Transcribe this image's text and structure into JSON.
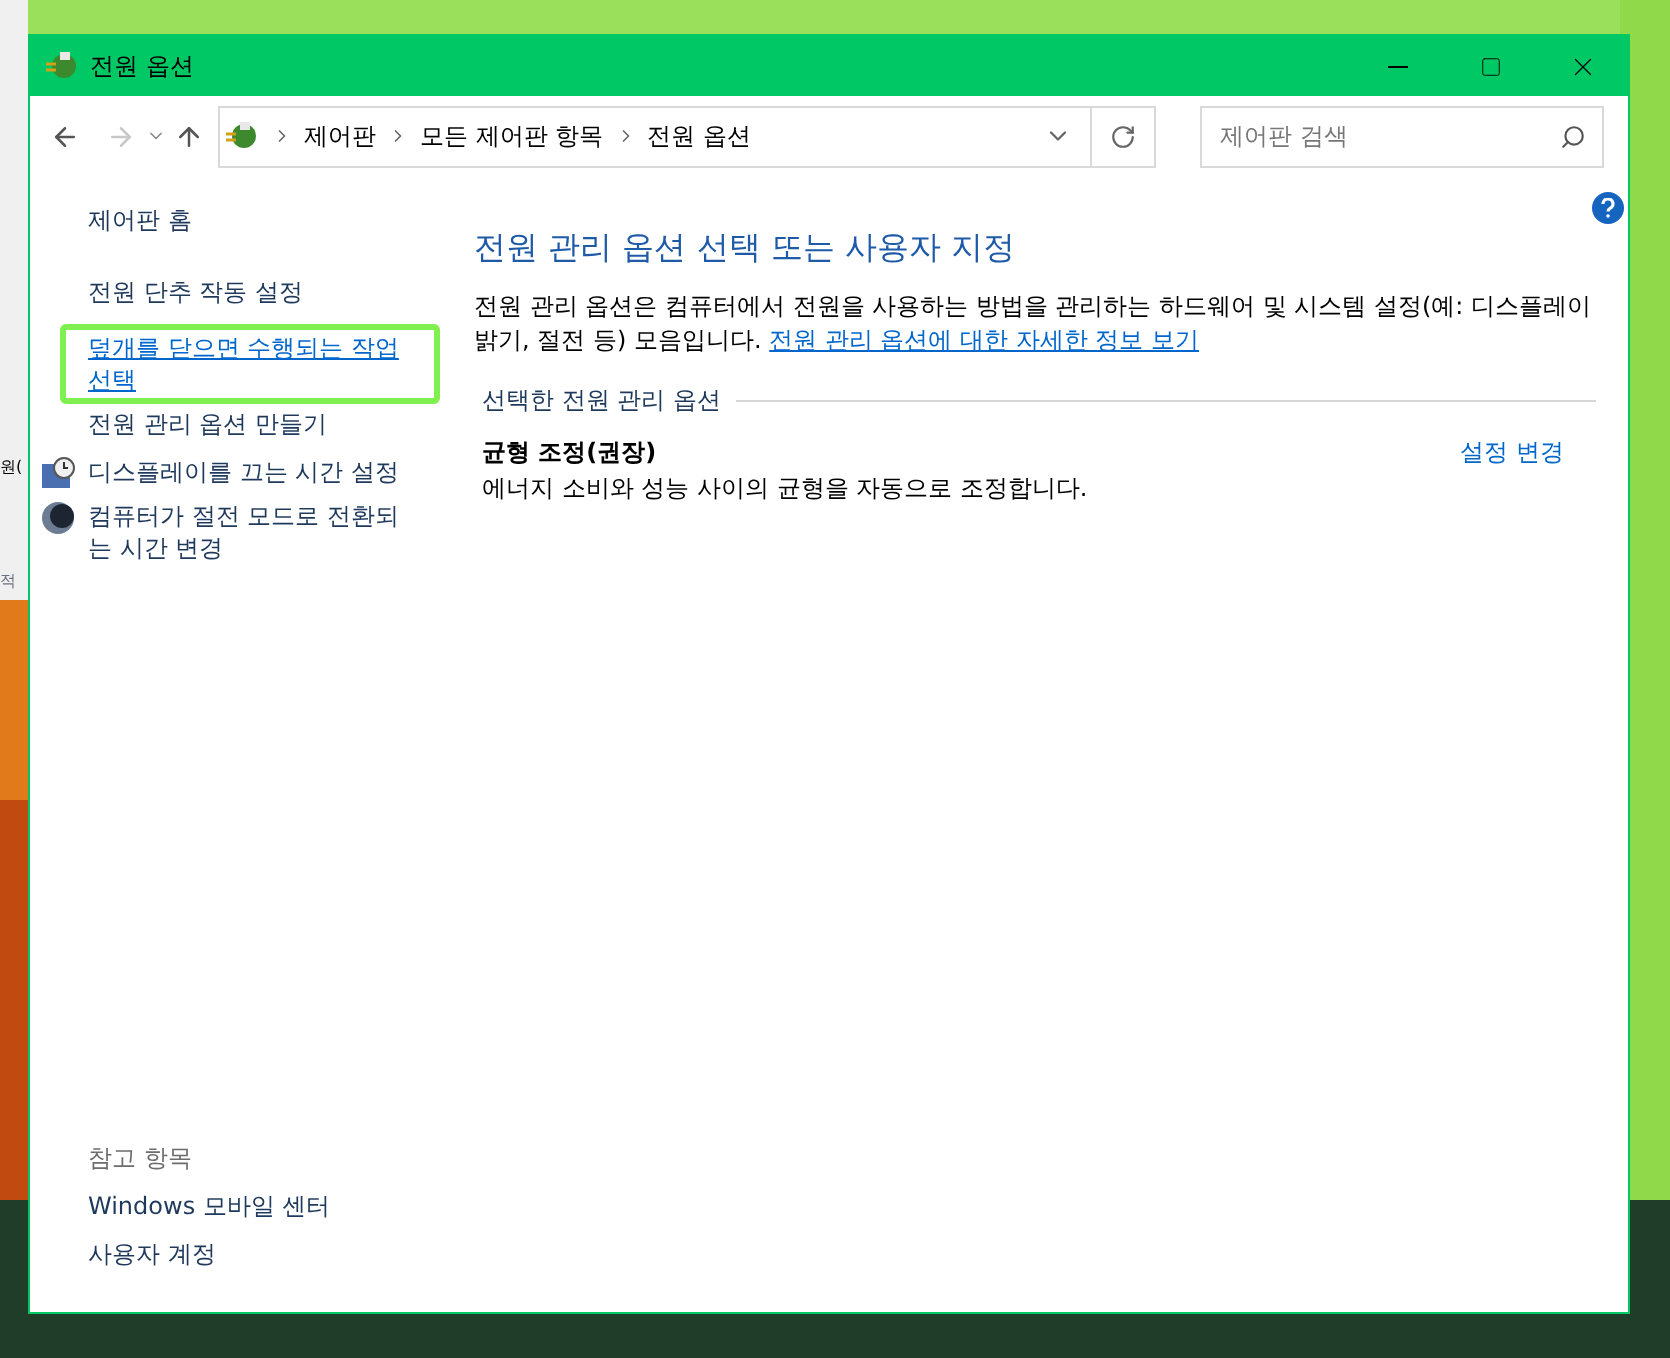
{
  "background_window": {
    "texts": [
      "원(",
      "적"
    ]
  },
  "window": {
    "title": "전원 옵션"
  },
  "nav": {
    "breadcrumb": [
      "제어판",
      "모든 제어판 항목",
      "전원 옵션"
    ],
    "search": {
      "placeholder": "제어판 검색"
    }
  },
  "sidebar": {
    "items": [
      {
        "label": "제어판 홈",
        "kind": "plain"
      },
      {
        "label": "전원 단추 작동 설정",
        "kind": "link"
      },
      {
        "label": "덮개를 닫으면 수행되는 작업 선택",
        "kind": "highlighted"
      },
      {
        "label": "전원 관리 옵션 만들기",
        "kind": "link"
      },
      {
        "label": "디스플레이를 끄는 시간 설정",
        "kind": "display"
      },
      {
        "label": "컴퓨터가 절전 모드로 전환되는 시간 변경",
        "kind": "sleep"
      }
    ]
  },
  "see_also": {
    "heading": "참고 항목",
    "items": [
      "Windows 모바일 센터",
      "사용자 계정"
    ]
  },
  "main": {
    "title": "전원 관리 옵션 선택 또는 사용자 지정",
    "description": "전원 관리 옵션은 컴퓨터에서 전원을 사용하는 방법을 관리하는 하드웨어 및 시스템 설정(예: 디스플레이 밝기, 절전 등) 모음입니다.",
    "more_link": "전원 관리 옵션에 대한 자세한 정보 보기",
    "section_title": "선택한 전원 관리 옵션",
    "plans": [
      {
        "name": "균형 조정(권장)",
        "description": "에너지 소비와 성능 사이의 균형을 자동으로 조정합니다.",
        "action": "설정 변경"
      }
    ]
  }
}
